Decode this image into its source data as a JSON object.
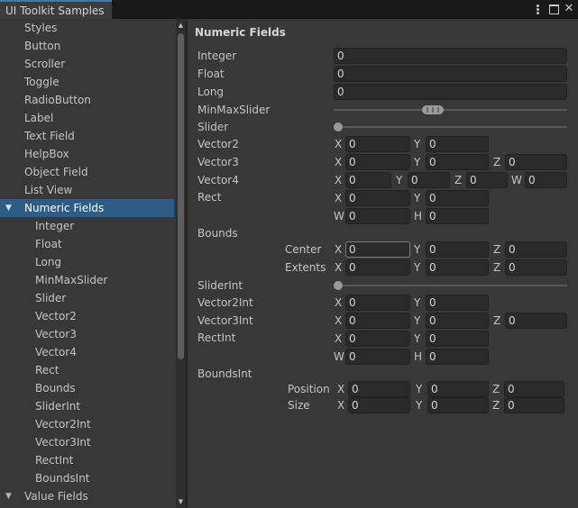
{
  "window": {
    "title": "UI Toolkit Samples",
    "menu_icon": "kebab-menu-icon",
    "maximize_icon": "maximize-icon",
    "close_icon": "close-icon",
    "close_glyph": "✕"
  },
  "sidebar": {
    "items": [
      {
        "label": "Styles"
      },
      {
        "label": "Button"
      },
      {
        "label": "Scroller"
      },
      {
        "label": "Toggle"
      },
      {
        "label": "RadioButton"
      },
      {
        "label": "Label"
      },
      {
        "label": "Text Field"
      },
      {
        "label": "HelpBox"
      },
      {
        "label": "Object Field"
      },
      {
        "label": "List View"
      },
      {
        "label": "Numeric Fields",
        "expanded": true,
        "selected": true,
        "arrow": "▼"
      },
      {
        "label": "Integer"
      },
      {
        "label": "Float"
      },
      {
        "label": "Long"
      },
      {
        "label": "MinMaxSlider"
      },
      {
        "label": "Slider"
      },
      {
        "label": "Vector2"
      },
      {
        "label": "Vector3"
      },
      {
        "label": "Vector4"
      },
      {
        "label": "Rect"
      },
      {
        "label": "Bounds"
      },
      {
        "label": "SliderInt"
      },
      {
        "label": "Vector2Int"
      },
      {
        "label": "Vector3Int"
      },
      {
        "label": "RectInt"
      },
      {
        "label": "BoundsInt"
      },
      {
        "label": "Value Fields",
        "expanded": true,
        "arrow": "▼"
      }
    ],
    "scroll_up": "▲",
    "scroll_down": "▼"
  },
  "main": {
    "heading": "Numeric Fields",
    "integer": {
      "label": "Integer",
      "value": "0"
    },
    "float": {
      "label": "Float",
      "value": "0"
    },
    "long": {
      "label": "Long",
      "value": "0"
    },
    "minmaxslider": {
      "label": "MinMaxSlider"
    },
    "slider": {
      "label": "Slider"
    },
    "vector2": {
      "label": "Vector2",
      "x": "0",
      "y": "0"
    },
    "vector3": {
      "label": "Vector3",
      "x": "0",
      "y": "0",
      "z": "0"
    },
    "vector4": {
      "label": "Vector4",
      "x": "0",
      "y": "0",
      "z": "0",
      "w": "0"
    },
    "rect": {
      "label": "Rect",
      "x": "0",
      "y": "0",
      "w": "0",
      "h": "0"
    },
    "bounds": {
      "label": "Bounds",
      "center": {
        "label": "Center",
        "x": "0",
        "y": "0",
        "z": "0"
      },
      "extents": {
        "label": "Extents",
        "x": "0",
        "y": "0",
        "z": "0"
      }
    },
    "sliderint": {
      "label": "SliderInt"
    },
    "vector2int": {
      "label": "Vector2Int",
      "x": "0",
      "y": "0"
    },
    "vector3int": {
      "label": "Vector3Int",
      "x": "0",
      "y": "0",
      "z": "0"
    },
    "rectint": {
      "label": "RectInt",
      "x": "0",
      "y": "0",
      "w": "0",
      "h": "0"
    },
    "boundsint": {
      "label": "BoundsInt",
      "position": {
        "label": "Position",
        "x": "0",
        "y": "0",
        "z": "0"
      },
      "size": {
        "label": "Size",
        "x": "0",
        "y": "0",
        "z": "0"
      }
    },
    "axes": {
      "x": "X",
      "y": "Y",
      "z": "Z",
      "w": "W",
      "h": "H"
    }
  },
  "colors": {
    "accent": "#3a79bb",
    "selection": "#2c5d87",
    "background": "#383838",
    "field": "#2a2a2a"
  }
}
